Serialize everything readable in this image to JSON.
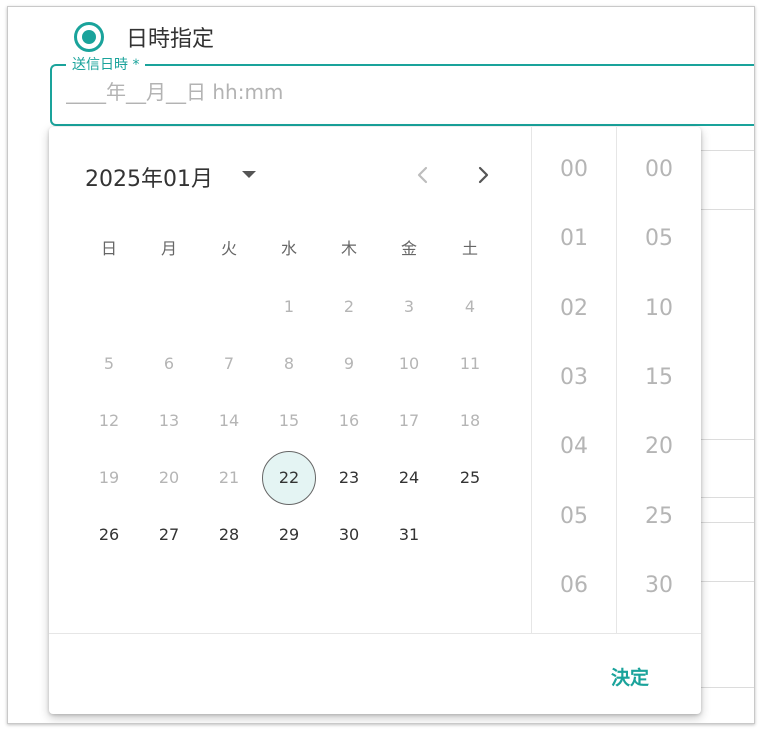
{
  "schedule": {
    "radio_label": "日時指定",
    "field_label": "送信日時 *",
    "field_placeholder": "____年__月__日 hh:mm",
    "field_value": ""
  },
  "picker": {
    "month_label": "2025年01月",
    "weekdays": [
      "日",
      "月",
      "火",
      "水",
      "木",
      "金",
      "土"
    ],
    "days": [
      {
        "label": "1",
        "state": "disabled"
      },
      {
        "label": "2",
        "state": "disabled"
      },
      {
        "label": "3",
        "state": "disabled"
      },
      {
        "label": "4",
        "state": "disabled"
      },
      {
        "label": "5",
        "state": "disabled"
      },
      {
        "label": "6",
        "state": "disabled"
      },
      {
        "label": "7",
        "state": "disabled"
      },
      {
        "label": "8",
        "state": "disabled"
      },
      {
        "label": "9",
        "state": "disabled"
      },
      {
        "label": "10",
        "state": "disabled"
      },
      {
        "label": "11",
        "state": "disabled"
      },
      {
        "label": "12",
        "state": "disabled"
      },
      {
        "label": "13",
        "state": "disabled"
      },
      {
        "label": "14",
        "state": "disabled"
      },
      {
        "label": "15",
        "state": "disabled"
      },
      {
        "label": "16",
        "state": "disabled"
      },
      {
        "label": "17",
        "state": "disabled"
      },
      {
        "label": "18",
        "state": "disabled"
      },
      {
        "label": "19",
        "state": "disabled"
      },
      {
        "label": "20",
        "state": "disabled"
      },
      {
        "label": "21",
        "state": "disabled"
      },
      {
        "label": "22",
        "state": "selected"
      },
      {
        "label": "23",
        "state": "enabled"
      },
      {
        "label": "24",
        "state": "enabled"
      },
      {
        "label": "25",
        "state": "enabled"
      },
      {
        "label": "26",
        "state": "enabled"
      },
      {
        "label": "27",
        "state": "enabled"
      },
      {
        "label": "28",
        "state": "enabled"
      },
      {
        "label": "29",
        "state": "enabled"
      },
      {
        "label": "30",
        "state": "enabled"
      },
      {
        "label": "31",
        "state": "enabled"
      }
    ],
    "first_weekday_index": 3,
    "hours": [
      "00",
      "01",
      "02",
      "03",
      "04",
      "05",
      "06"
    ],
    "minutes": [
      "00",
      "05",
      "10",
      "15",
      "20",
      "25",
      "30"
    ],
    "confirm_label": "決定"
  },
  "icons": {
    "prev": "chevron-left-icon",
    "next": "chevron-right-icon",
    "month_dropdown": "caret-down-icon",
    "radio": "radio-checked-icon"
  },
  "colors": {
    "accent": "#1aa39b",
    "selected_day_bg": "#e4f4f3",
    "disabled_text": "#b5b5b5"
  }
}
